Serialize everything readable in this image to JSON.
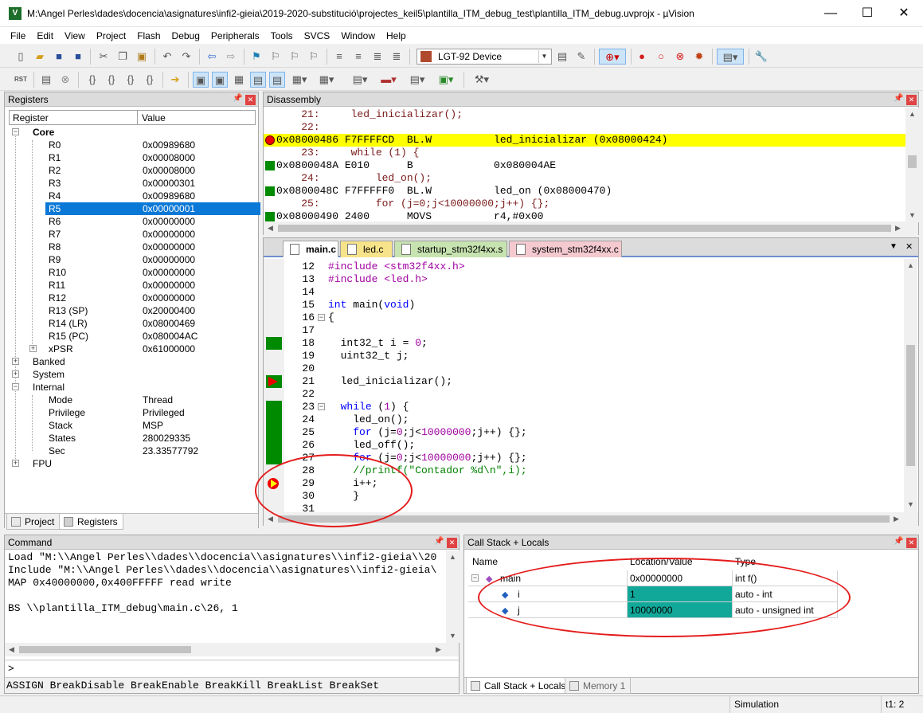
{
  "window": {
    "title": "M:\\Angel Perles\\dades\\docencia\\asignatures\\infi2-gieia\\2019-2020-substitució\\projectes_keil5\\plantilla_ITM_debug_test\\plantilla_ITM_debug.uvprojx - µVision",
    "app_icon": "V",
    "minimize": "—",
    "maximize": "☐",
    "close": "✕"
  },
  "menu": [
    "File",
    "Edit",
    "View",
    "Project",
    "Flash",
    "Debug",
    "Peripherals",
    "Tools",
    "SVCS",
    "Window",
    "Help"
  ],
  "toolbar1": {
    "device": "LGT-92 Device"
  },
  "toolbar2": {
    "reset_label": "RST"
  },
  "registers": {
    "title": "Registers",
    "col_register": "Register",
    "col_value": "Value",
    "core_label": "Core",
    "core_rows": [
      {
        "name": "R0",
        "value": "0x00989680"
      },
      {
        "name": "R1",
        "value": "0x00008000"
      },
      {
        "name": "R2",
        "value": "0x00008000"
      },
      {
        "name": "R3",
        "value": "0x00000301"
      },
      {
        "name": "R4",
        "value": "0x00989680"
      },
      {
        "name": "R5",
        "value": "0x00000001"
      },
      {
        "name": "R6",
        "value": "0x00000000"
      },
      {
        "name": "R7",
        "value": "0x00000000"
      },
      {
        "name": "R8",
        "value": "0x00000000"
      },
      {
        "name": "R9",
        "value": "0x00000000"
      },
      {
        "name": "R10",
        "value": "0x00000000"
      },
      {
        "name": "R11",
        "value": "0x00000000"
      },
      {
        "name": "R12",
        "value": "0x00000000"
      },
      {
        "name": "R13 (SP)",
        "value": "0x20000400"
      },
      {
        "name": "R14 (LR)",
        "value": "0x08000469"
      },
      {
        "name": "R15 (PC)",
        "value": "0x080004AC"
      },
      {
        "name": "xPSR",
        "value": "0x61000000"
      }
    ],
    "selected_row": "R5",
    "banked_label": "Banked",
    "system_label": "System",
    "internal_label": "Internal",
    "internal_rows": [
      {
        "name": "Mode",
        "value": "Thread"
      },
      {
        "name": "Privilege",
        "value": "Privileged"
      },
      {
        "name": "Stack",
        "value": "MSP"
      },
      {
        "name": "States",
        "value": "280029335"
      },
      {
        "name": "Sec",
        "value": "23.33577792"
      }
    ],
    "fpu_label": "FPU",
    "tabs": [
      "Project",
      "Registers"
    ]
  },
  "disassembly": {
    "title": "Disassembly",
    "lines": [
      {
        "text": "    21:     led_inicializar();",
        "kind": "src",
        "mark": ""
      },
      {
        "text": "    22: ",
        "kind": "src",
        "mark": ""
      },
      {
        "text": "0x08000486 F7FFFFCD  BL.W          led_inicializar (0x08000424)",
        "kind": "asm",
        "mark": "bp",
        "current": true
      },
      {
        "text": "    23:     while (1) {",
        "kind": "src",
        "mark": ""
      },
      {
        "text": "0x0800048A E010      B             0x080004AE",
        "kind": "asm",
        "mark": "exec"
      },
      {
        "text": "    24:         led_on();",
        "kind": "src",
        "mark": ""
      },
      {
        "text": "0x0800048C F7FFFFF0  BL.W          led_on (0x08000470)",
        "kind": "asm",
        "mark": "exec"
      },
      {
        "text": "    25:         for (j=0;j<10000000;j++) {};",
        "kind": "src",
        "mark": ""
      },
      {
        "text": "0x08000490 2400      MOVS          r4,#0x00",
        "kind": "asm",
        "mark": "exec"
      }
    ]
  },
  "editor": {
    "tabs": [
      "main.c",
      "led.c",
      "startup_stm32f4xx.s",
      "system_stm32f4xx.c"
    ],
    "active_tab": "main.c",
    "lines": [
      {
        "n": "12",
        "code": "#include <stm32f4xx.h>"
      },
      {
        "n": "13",
        "code": "#include <led.h>"
      },
      {
        "n": "14",
        "code": ""
      },
      {
        "n": "15",
        "code": "int main(void)"
      },
      {
        "n": "16",
        "code": "{"
      },
      {
        "n": "17",
        "code": ""
      },
      {
        "n": "18",
        "code": "  int32_t i = 0;"
      },
      {
        "n": "19",
        "code": "  uint32_t j;"
      },
      {
        "n": "20",
        "code": ""
      },
      {
        "n": "21",
        "code": "  led_inicializar();"
      },
      {
        "n": "22",
        "code": ""
      },
      {
        "n": "23",
        "code": "  while (1) {"
      },
      {
        "n": "24",
        "code": "    led_on();"
      },
      {
        "n": "25",
        "code": "    for (j=0;j<10000000;j++) {};"
      },
      {
        "n": "26",
        "code": "    led_off();"
      },
      {
        "n": "27",
        "code": "    for (j=0;j<10000000;j++) {};"
      },
      {
        "n": "28",
        "code": "    //printf(\"Contador %d\\n\",i);"
      },
      {
        "n": "29",
        "code": "    i++;"
      },
      {
        "n": "30",
        "code": "    }"
      },
      {
        "n": "31",
        "code": ""
      }
    ]
  },
  "command": {
    "title": "Command",
    "lines": [
      "Load \"M:\\\\Angel Perles\\\\dades\\\\docencia\\\\asignatures\\\\infi2-gieia\\\\20",
      "Include \"M:\\\\Angel Perles\\\\dades\\\\docencia\\\\asignatures\\\\infi2-gieia\\",
      "MAP 0x40000000,0x400FFFFF read write",
      "",
      "BS \\\\plantilla_ITM_debug\\main.c\\26, 1"
    ],
    "prompt": ">",
    "hints": "ASSIGN BreakDisable BreakEnable BreakKill BreakList BreakSet"
  },
  "callstack": {
    "title": "Call Stack + Locals",
    "col_name": "Name",
    "col_location": "Location/Value",
    "col_type": "Type",
    "rows": [
      {
        "name": "main",
        "value": "0x00000000",
        "type": "int f()"
      },
      {
        "name": "i",
        "value": "1",
        "type": "auto - int"
      },
      {
        "name": "j",
        "value": "10000000",
        "type": "auto - unsigned int"
      }
    ],
    "tabs": [
      "Call Stack + Locals",
      "Memory 1"
    ]
  },
  "status": {
    "mode": "Simulation",
    "time": "t1: 2"
  },
  "colors": {
    "highlight_yellow": "#ffff00",
    "exec_green": "#008a00",
    "selection_blue": "#0a78d7",
    "annotation_red": "#e41b1b",
    "locals_teal": "#11a89a"
  }
}
